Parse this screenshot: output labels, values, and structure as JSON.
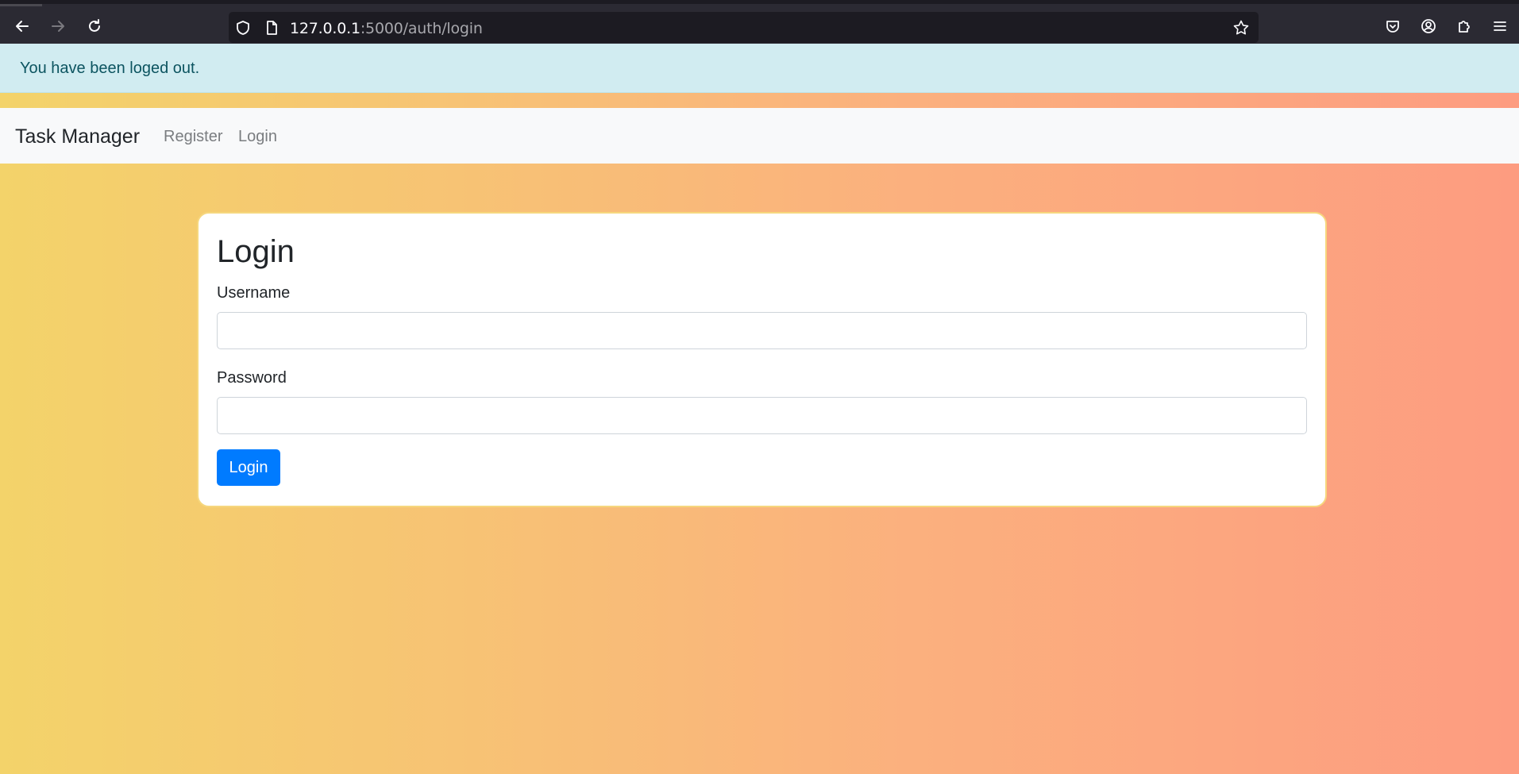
{
  "browser": {
    "url_host": "127.0.0.1",
    "url_path": ":5000/auth/login"
  },
  "alert": {
    "message": "You have been loged out."
  },
  "navbar": {
    "brand": "Task Manager",
    "links": [
      "Register",
      "Login"
    ]
  },
  "login_form": {
    "title": "Login",
    "username_label": "Username",
    "username_value": "",
    "password_label": "Password",
    "password_value": "",
    "submit_label": "Login"
  },
  "colors": {
    "alert_bg": "#d1ecf1",
    "alert_text": "#0c5460",
    "primary": "#007bff",
    "gradient_start": "#f3d36a",
    "gradient_end": "#fd9c80"
  }
}
